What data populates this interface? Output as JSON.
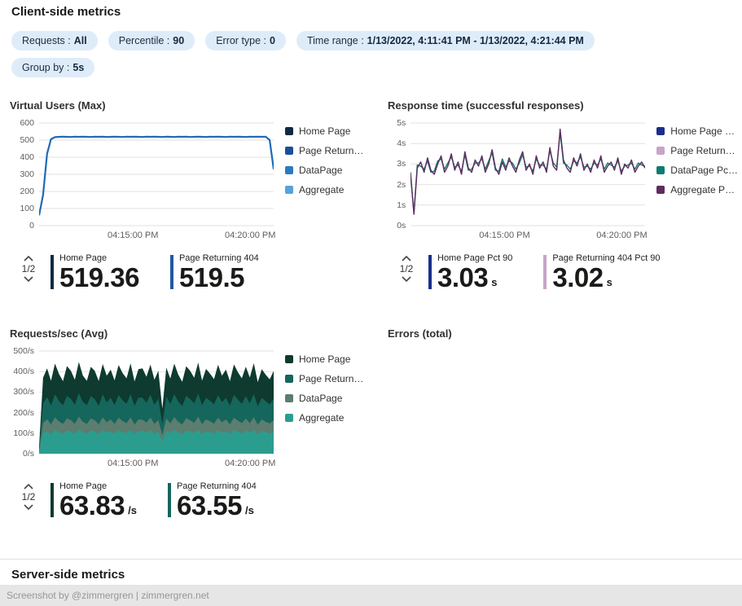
{
  "page": {
    "title": "Client-side metrics",
    "server_section_title": "Server-side metrics",
    "footer_text": "Screenshot by @zimmergren | zimmergren.net"
  },
  "filters": [
    {
      "label": "Requests :",
      "value": "All"
    },
    {
      "label": "Percentile :",
      "value": "90"
    },
    {
      "label": "Error type :",
      "value": "0"
    },
    {
      "label": "Time range :",
      "value": "1/13/2022, 4:11:41 PM - 1/13/2022, 4:21:44 PM"
    },
    {
      "label": "Group by :",
      "value": "5s"
    }
  ],
  "chart_data": [
    {
      "type": "line",
      "title": "Virtual Users (Max)",
      "ylim": [
        0,
        600
      ],
      "yticks": [
        "600",
        "500",
        "400",
        "300",
        "200",
        "100",
        "0"
      ],
      "xticks": [
        {
          "label": "04:15:00 PM",
          "pos": 0.4
        },
        {
          "label": "04:20:00 PM",
          "pos": 0.9
        }
      ],
      "legend": [
        {
          "label": "Home Page",
          "color": "#102a43"
        },
        {
          "label": "Page Return…",
          "color": "#1b4f9c"
        },
        {
          "label": "DataPage",
          "color": "#2a7ac2"
        },
        {
          "label": "Aggregate",
          "color": "#55a3da"
        }
      ],
      "series": [
        {
          "name": "Aggregate",
          "color": "#1f6ab5",
          "width": 2.2,
          "values": [
            60,
            180,
            420,
            505,
            517,
            519,
            520,
            519,
            518,
            520,
            519,
            520,
            519,
            518,
            520,
            519,
            520,
            518,
            519,
            520,
            519,
            518,
            520,
            519,
            520,
            519,
            518,
            520,
            519,
            520,
            519,
            518,
            520,
            519,
            518,
            520,
            519,
            520,
            518,
            519,
            520,
            519,
            518,
            520,
            519,
            520,
            519,
            518,
            520,
            519,
            520,
            519,
            518,
            520,
            519,
            520,
            519,
            520,
            500,
            330
          ]
        }
      ],
      "pager": "1/2",
      "stats": [
        {
          "label": "Home Page",
          "value": "519.36",
          "suffix": "",
          "color": "#102a43"
        },
        {
          "label": "Page Returning 404",
          "value": "519.5",
          "suffix": "",
          "color": "#2456a4"
        }
      ]
    },
    {
      "type": "line",
      "title": "Response time (successful responses)",
      "ylim": [
        0,
        5
      ],
      "yticks": [
        "5s",
        "4s",
        "3s",
        "2s",
        "1s",
        "0s"
      ],
      "xticks": [
        {
          "label": "04:15:00 PM",
          "pos": 0.4
        },
        {
          "label": "04:20:00 PM",
          "pos": 0.9
        }
      ],
      "legend": [
        {
          "label": "Home Page …",
          "color": "#1b2d8c"
        },
        {
          "label": "Page Return…",
          "color": "#c9a3c9"
        },
        {
          "label": "DataPage Pc…",
          "color": "#0f7b72"
        },
        {
          "label": "Aggregate P…",
          "color": "#5e2c5e"
        }
      ],
      "series": [
        {
          "name": "DataPage Pct 90",
          "color": "#0f7b72",
          "width": 1.4,
          "values": [
            2.5,
            0.6,
            2.95,
            2.9,
            2.75,
            3.15,
            2.6,
            2.65,
            3.15,
            3.25,
            2.75,
            3.05,
            3.35,
            2.85,
            2.95,
            2.65,
            3.45,
            2.7,
            2.75,
            3.05,
            3.05,
            3.25,
            2.75,
            3.15,
            3.55,
            2.7,
            2.65,
            3.25,
            2.85,
            3.15,
            3.05,
            2.75,
            3.05,
            3.45,
            2.85,
            2.9,
            2.65,
            3.25,
            2.95,
            2.95,
            2.75,
            3.65,
            3.05,
            2.85,
            4.55,
            3.05,
            2.95,
            2.75,
            3.15,
            3.05,
            3.35,
            2.85,
            2.9,
            2.75,
            3.05,
            2.95,
            3.25,
            2.75,
            3.05,
            2.95,
            2.85,
            3.15,
            2.65,
            2.9,
            2.95,
            3.05,
            2.75,
            3.05,
            2.95,
            2.9
          ]
        },
        {
          "name": "Aggregate Pct 90",
          "color": "#5e2c5e",
          "width": 1.4,
          "values": [
            2.6,
            0.55,
            2.8,
            3.1,
            2.6,
            3.3,
            2.7,
            2.5,
            3.0,
            3.4,
            2.6,
            2.9,
            3.5,
            2.7,
            3.1,
            2.5,
            3.6,
            2.8,
            2.6,
            3.2,
            2.9,
            3.4,
            2.6,
            3.0,
            3.7,
            2.8,
            2.5,
            3.1,
            2.7,
            3.3,
            2.9,
            2.6,
            3.2,
            3.6,
            2.7,
            3.0,
            2.5,
            3.4,
            2.8,
            3.1,
            2.6,
            3.8,
            2.9,
            2.7,
            4.7,
            3.2,
            2.8,
            2.6,
            3.3,
            2.9,
            3.5,
            2.7,
            3.0,
            2.6,
            3.2,
            2.8,
            3.4,
            2.6,
            2.9,
            3.1,
            2.7,
            3.3,
            2.5,
            3.0,
            2.8,
            3.2,
            2.6,
            2.9,
            3.1,
            2.8
          ]
        }
      ],
      "pager": "1/2",
      "stats": [
        {
          "label": "Home Page Pct 90",
          "value": "3.03",
          "suffix": "s",
          "color": "#1b2d8c"
        },
        {
          "label": "Page Returning 404 Pct 90",
          "value": "3.02",
          "suffix": "s",
          "color": "#c9a3c9"
        }
      ]
    },
    {
      "type": "area-stacked",
      "title": "Requests/sec (Avg)",
      "ylim": [
        0,
        500
      ],
      "yticks": [
        "500/s",
        "400/s",
        "300/s",
        "200/s",
        "100/s",
        "0/s"
      ],
      "xticks": [
        {
          "label": "04:15:00 PM",
          "pos": 0.4
        },
        {
          "label": "04:20:00 PM",
          "pos": 0.9
        }
      ],
      "legend": [
        {
          "label": "Home Page",
          "color": "#0e3a2f"
        },
        {
          "label": "Page Return…",
          "color": "#15665c"
        },
        {
          "label": "DataPage",
          "color": "#5c7d6f"
        },
        {
          "label": "Aggregate",
          "color": "#2a9d8f"
        }
      ],
      "series": [
        {
          "name": "Aggregate",
          "color": "#2a9d8f",
          "values": [
            10,
            100,
            110,
            95,
            115,
            105,
            98,
            112,
            108,
            96,
            118,
            104,
            99,
            113,
            107,
            95,
            116,
            103,
            110,
            98,
            114,
            106,
            100,
            117,
            96,
            109,
            112,
            101,
            115,
            97,
            108,
            60,
            112,
            99,
            116,
            104,
            95,
            113,
            108,
            100,
            117,
            96,
            110,
            105,
            98,
            114,
            102,
            109,
            96,
            115,
            107,
            99,
            113,
            101,
            116,
            95,
            110,
            104,
            98,
            108
          ]
        },
        {
          "name": "DataPage",
          "color": "#5c7d6f",
          "values": [
            6,
            50,
            58,
            48,
            62,
            52,
            47,
            60,
            55,
            49,
            63,
            51,
            46,
            59,
            56,
            48,
            61,
            50,
            57,
            47,
            62,
            53,
            49,
            60,
            46,
            58,
            54,
            51,
            61,
            48,
            56,
            30,
            59,
            49,
            62,
            52,
            47,
            60,
            55,
            50,
            63,
            48,
            57,
            53,
            49,
            61,
            51,
            58,
            47,
            60,
            54,
            50,
            59,
            48,
            62,
            46,
            57,
            52,
            49,
            55
          ]
        },
        {
          "name": "Page Returning 404",
          "color": "#15665c",
          "values": [
            8,
            95,
            108,
            92,
            112,
            100,
            90,
            110,
            104,
            93,
            114,
            98,
            91,
            109,
            103,
            90,
            112,
            97,
            105,
            92,
            110,
            101,
            94,
            113,
            91,
            106,
            108,
            96,
            111,
            93,
            104,
            55,
            107,
            94,
            112,
            99,
            90,
            109,
            103,
            95,
            113,
            92,
            106,
            100,
            93,
            111,
            98,
            105,
            91,
            112,
            102,
            94,
            109,
            96,
            113,
            90,
            106,
            99,
            93,
            104
          ]
        },
        {
          "name": "Home Page",
          "color": "#0e3a2f",
          "values": [
            12,
            125,
            140,
            120,
            150,
            132,
            118,
            145,
            136,
            122,
            152,
            128,
            119,
            142,
            138,
            121,
            148,
            130,
            137,
            120,
            146,
            133,
            124,
            150,
            119,
            139,
            142,
            127,
            147,
            122,
            136,
            75,
            141,
            124,
            149,
            131,
            118,
            144,
            137,
            125,
            151,
            120,
            140,
            132,
            123,
            147,
            129,
            138,
            119,
            148,
            134,
            124,
            143,
            126,
            150,
            118,
            139,
            130,
            122,
            136
          ]
        }
      ],
      "pager": "1/2",
      "stats": [
        {
          "label": "Home Page",
          "value": "63.83",
          "suffix": "/s",
          "color": "#0e3a2f"
        },
        {
          "label": "Page Returning 404",
          "value": "63.55",
          "suffix": "/s",
          "color": "#15665c"
        }
      ]
    },
    {
      "type": "empty",
      "title": "Errors (total)"
    }
  ]
}
